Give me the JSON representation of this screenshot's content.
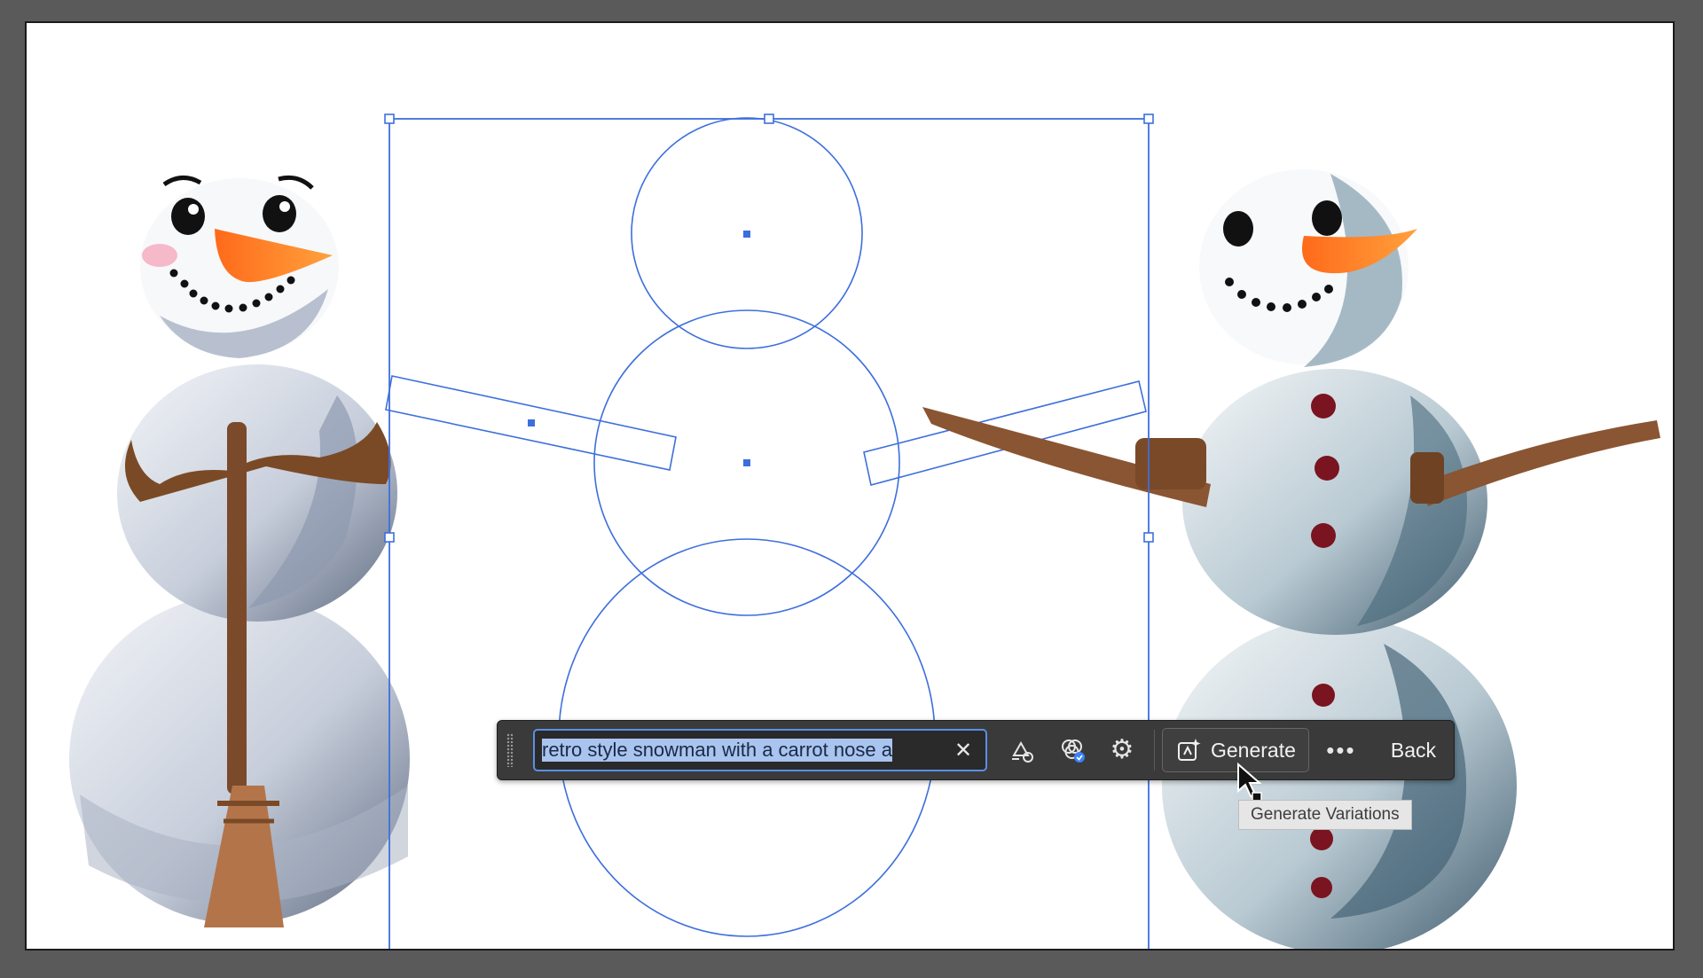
{
  "canvas": {
    "background": "#ffffff",
    "pasteboard": "#5a5a5a",
    "selection_color": "#3d6fdc",
    "objects": [
      "snowman-with-broom",
      "snowman-outline-shapes",
      "generated-snowman-variation"
    ]
  },
  "taskbar": {
    "prompt_value": "retro style snowman with a carrot nose a",
    "clear_icon": "close-icon",
    "tools": [
      {
        "icon": "shape-style-icon"
      },
      {
        "icon": "color-match-icon"
      },
      {
        "icon": "gear-icon"
      }
    ],
    "generate_label": "Generate",
    "generate_icon": "generate-sparkle-icon",
    "more_icon": "more-horizontal-icon",
    "more_label": "•••",
    "back_label": "Back",
    "accent": "#5a8fe6"
  },
  "tooltip": {
    "text": "Generate Variations"
  }
}
